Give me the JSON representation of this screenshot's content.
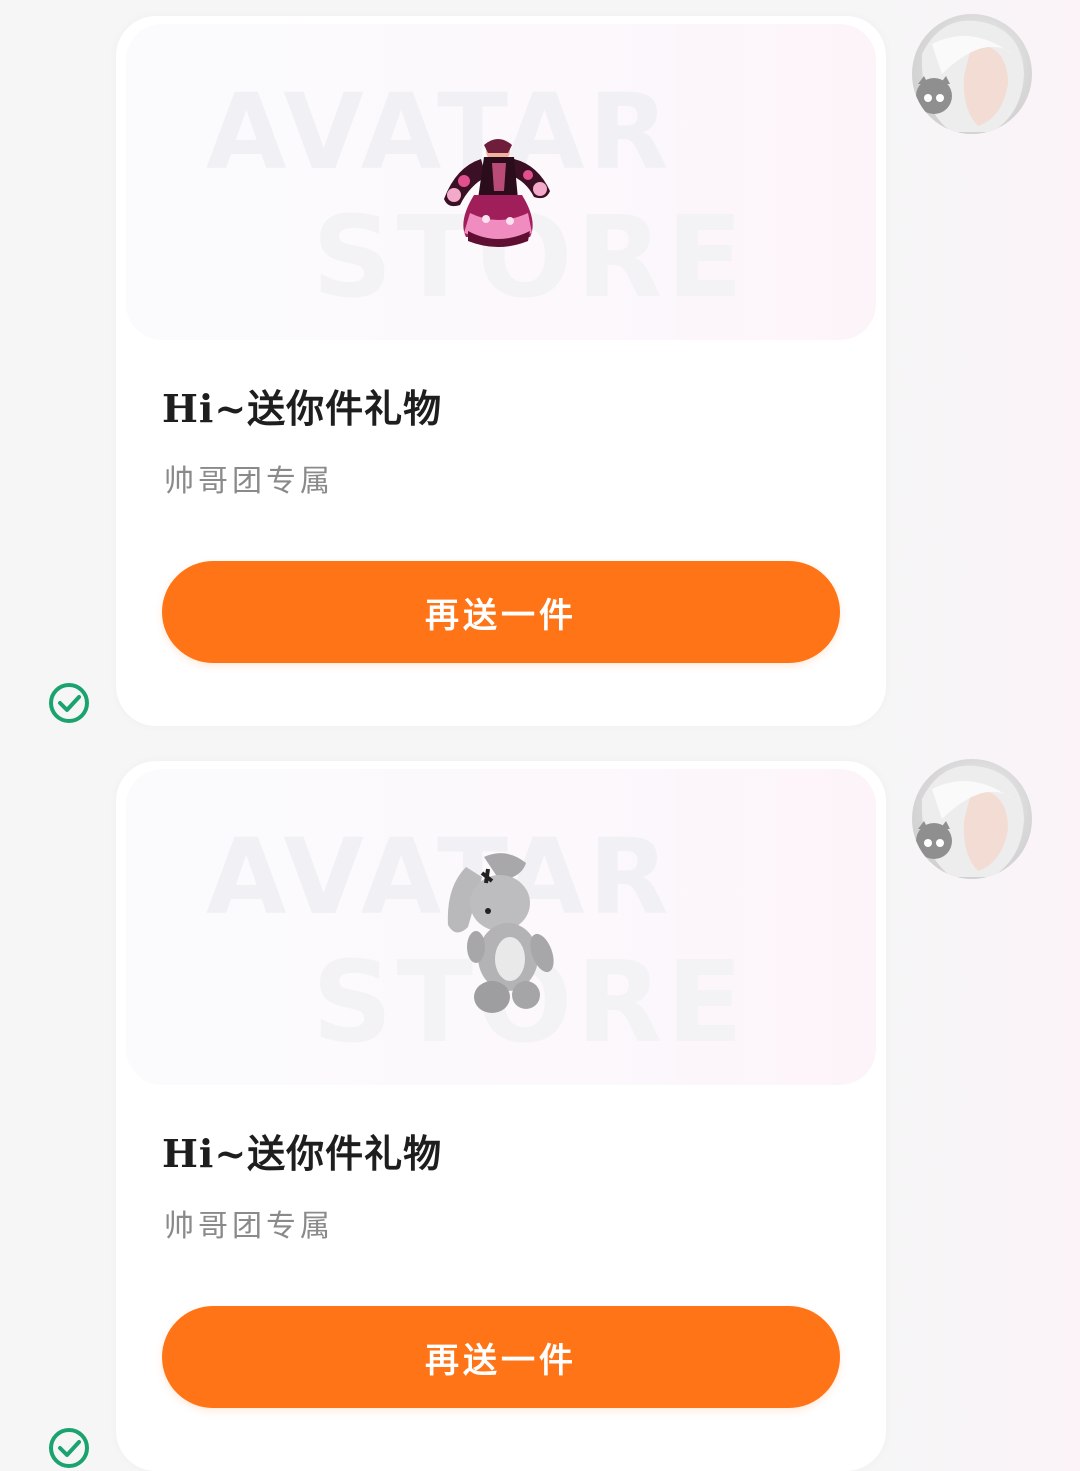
{
  "messages": [
    {
      "banner": {
        "watermark_top": "AVATAR",
        "watermark_bottom": "STORE",
        "item_icon": "dress-icon"
      },
      "title": "Hi~送你件礼物",
      "subtitle": "帅哥团专属",
      "button_label": "再送一件",
      "status_icon": "check-circle-icon",
      "avatar_icon": "user-avatar"
    },
    {
      "banner": {
        "watermark_top": "AVATAR",
        "watermark_bottom": "STORE",
        "item_icon": "bunny-plush-icon"
      },
      "title": "Hi~送你件礼物",
      "subtitle": "帅哥团专属",
      "button_label": "再送一件",
      "status_icon": "check-circle-icon",
      "avatar_icon": "user-avatar"
    }
  ],
  "colors": {
    "button": "#ff7417",
    "check": "#1aa36f",
    "title": "#1e1e1e",
    "subtitle": "#8a8a8a"
  }
}
